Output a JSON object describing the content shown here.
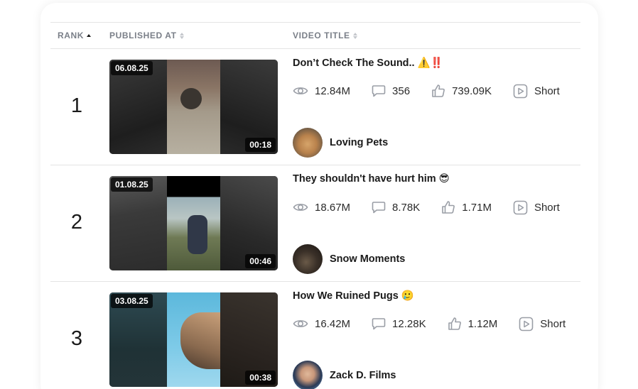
{
  "table": {
    "headers": {
      "rank": "RANK",
      "published": "PUBLISHED AT",
      "title": "VIDEO TITLE"
    },
    "rows": [
      {
        "rank": "1",
        "date": "06.08.25",
        "duration": "00:18",
        "title": "Don’t Check The Sound.. ⚠️‼️",
        "views": "12.84M",
        "comments": "356",
        "likes": "739.09K",
        "type": "Short",
        "channel": "Loving Pets",
        "avatar_icon": "puppy-avatar"
      },
      {
        "rank": "2",
        "date": "01.08.25",
        "duration": "00:46",
        "title": "They shouldn't have hurt him 😎",
        "views": "18.67M",
        "comments": "8.78K",
        "likes": "1.71M",
        "type": "Short",
        "channel": "Snow Moments",
        "avatar_icon": "person-avatar"
      },
      {
        "rank": "3",
        "date": "03.08.25",
        "duration": "00:38",
        "title": "How We Ruined Pugs 🥲",
        "views": "16.42M",
        "comments": "12.28K",
        "likes": "1.12M",
        "type": "Short",
        "channel": "Zack D. Films",
        "avatar_icon": "man-avatar"
      }
    ]
  },
  "icons": {
    "views": "eye-icon",
    "comments": "comment-icon",
    "likes": "thumbs-up-icon",
    "type": "play-square-icon",
    "sort": "sort-arrows-icon"
  },
  "colors": {
    "header_text": "#7a7f88",
    "divider": "#e4e4e4",
    "icon_gray": "#9a9ea6"
  }
}
